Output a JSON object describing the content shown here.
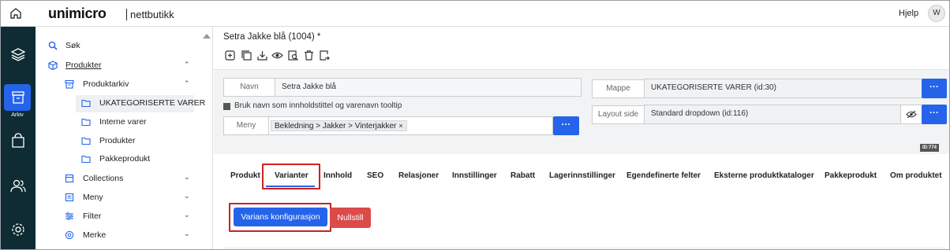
{
  "header": {
    "brand_main": "unimicro",
    "brand_sub": "nettbutikk",
    "help": "Hjelp",
    "avatar": "W"
  },
  "rail": {
    "active_label": "Arkiv"
  },
  "sidebar": {
    "search": "Søk",
    "products": "Produkter",
    "product_archive": "Produktarkiv",
    "folders": [
      "UKATEGORISERTE VARER",
      "Interne varer",
      "Produkter",
      "Pakkeprodukt"
    ],
    "collections": "Collections",
    "menu": "Meny",
    "filter": "Filter",
    "brand": "Merke"
  },
  "product": {
    "title": "Setra Jakke blå (1004) *"
  },
  "form": {
    "name_label": "Navn",
    "name_value": "Setra Jakke blå",
    "use_name_checkbox": "Bruk navn som innholdstittel og varenavn tooltip",
    "menu_label": "Meny",
    "menu_chip": "Bekledning > Jakker > Vinterjakker",
    "chip_remove": "×",
    "folder_label": "Mappe",
    "folder_value": "UKATEGORISERTE VARER (id:30)",
    "layout_label": "Layout side",
    "layout_value": "Standard dropdown (id:116)",
    "dots": "···",
    "id_badge": "ID:774"
  },
  "tabs": [
    "Produkt",
    "Varianter",
    "Innhold",
    "SEO",
    "Relasjoner",
    "Innstillinger",
    "Rabatt",
    "Lagerinnstillinger",
    "Egendefinerte felter",
    "Eksterne produktkataloger",
    "Pakkeprodukt",
    "Om produktet"
  ],
  "actions": {
    "variant_config": "Varians konfigurasjon",
    "reset": "Nullstill"
  },
  "colors": {
    "rail": "#0f2b33",
    "accent": "#2563eb",
    "danger": "#dc4a4a",
    "highlight": "#cc2222"
  }
}
